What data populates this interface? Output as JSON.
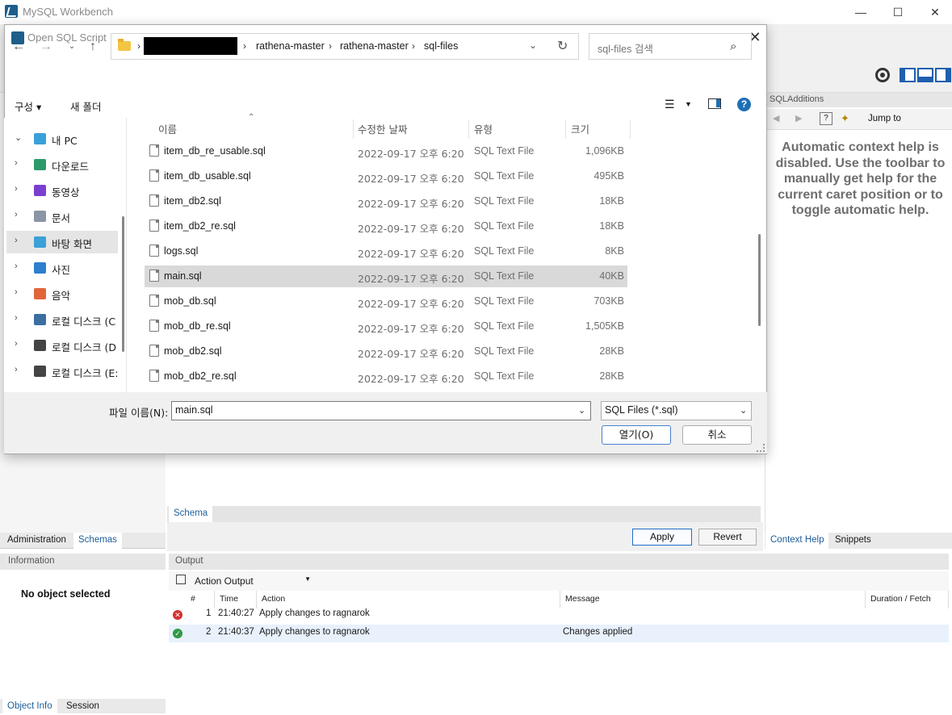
{
  "window": {
    "title": "MySQL Workbench",
    "minimize_glyph": "—",
    "maximize_glyph": "☐",
    "close_glyph": "✕"
  },
  "sidebar": {
    "tabs": [
      "Administration",
      "Schemas"
    ],
    "info_header": "Information",
    "no_object": "No object selected",
    "bottom_tabs": [
      "Object Info",
      "Session"
    ]
  },
  "editor": {
    "schema_tab": "Schema",
    "apply_label": "Apply",
    "revert_label": "Revert"
  },
  "right_panel": {
    "header": "SQLAdditions",
    "jump_to": "Jump to",
    "help_text": "Automatic context help is disabled. Use the toolbar to manually get help for the current caret position or to toggle automatic help.",
    "tabs": [
      "Context Help",
      "Snippets"
    ]
  },
  "output": {
    "header": "Output",
    "selector": "Action Output",
    "columns": [
      "#",
      "Time",
      "Action",
      "Message",
      "Duration / Fetch"
    ],
    "rows": [
      {
        "status": "error",
        "num": "1",
        "time": "21:40:27",
        "action": "Apply changes to ragnarok",
        "message": "",
        "duration": ""
      },
      {
        "status": "ok",
        "num": "2",
        "time": "21:40:37",
        "action": "Apply changes to ragnarok",
        "message": "Changes applied",
        "duration": ""
      }
    ]
  },
  "dialog": {
    "title": "Open SQL Script",
    "close_glyph": "✕",
    "breadcrumbs": [
      "rathena-master",
      "rathena-master",
      "sql-files"
    ],
    "search_placeholder": "sql-files 검색",
    "organize": "구성 ▾",
    "new_folder": "새 폴더",
    "nav": [
      {
        "label": "내 PC",
        "chev": "⌄",
        "color": "#3aa0d8"
      },
      {
        "label": "다운로드",
        "chev": "›",
        "color": "#2e9a6a"
      },
      {
        "label": "동영상",
        "chev": "›",
        "color": "#7b3fd0"
      },
      {
        "label": "문서",
        "chev": "›",
        "color": "#8a95a5"
      },
      {
        "label": "바탕 화면",
        "chev": "›",
        "color": "#3aa0d8"
      },
      {
        "label": "사진",
        "chev": "›",
        "color": "#2f7fd0"
      },
      {
        "label": "음악",
        "chev": "›",
        "color": "#e0663a"
      },
      {
        "label": "로컬 디스크 (C",
        "chev": "›",
        "color": "#3a6fa0"
      },
      {
        "label": "로컬 디스크 (D",
        "chev": "›",
        "color": "#444444"
      },
      {
        "label": "로컬 디스크 (E:",
        "chev": "›",
        "color": "#444444"
      }
    ],
    "selected_nav": 4,
    "columns": [
      "이름",
      "수정한 날짜",
      "유형",
      "크기"
    ],
    "files": [
      {
        "name": "item_db_re_usable.sql",
        "date": "2022-09-17 오후 6:20",
        "type": "SQL Text File",
        "size": "1,096KB"
      },
      {
        "name": "item_db_usable.sql",
        "date": "2022-09-17 오후 6:20",
        "type": "SQL Text File",
        "size": "495KB"
      },
      {
        "name": "item_db2.sql",
        "date": "2022-09-17 오후 6:20",
        "type": "SQL Text File",
        "size": "18KB"
      },
      {
        "name": "item_db2_re.sql",
        "date": "2022-09-17 오후 6:20",
        "type": "SQL Text File",
        "size": "18KB"
      },
      {
        "name": "logs.sql",
        "date": "2022-09-17 오후 6:20",
        "type": "SQL Text File",
        "size": "8KB"
      },
      {
        "name": "main.sql",
        "date": "2022-09-17 오후 6:20",
        "type": "SQL Text File",
        "size": "40KB"
      },
      {
        "name": "mob_db.sql",
        "date": "2022-09-17 오후 6:20",
        "type": "SQL Text File",
        "size": "703KB"
      },
      {
        "name": "mob_db_re.sql",
        "date": "2022-09-17 오후 6:20",
        "type": "SQL Text File",
        "size": "1,505KB"
      },
      {
        "name": "mob_db2.sql",
        "date": "2022-09-17 오후 6:20",
        "type": "SQL Text File",
        "size": "28KB"
      },
      {
        "name": "mob_db2_re.sql",
        "date": "2022-09-17 오후 6:20",
        "type": "SQL Text File",
        "size": "28KB"
      }
    ],
    "selected_file": 5,
    "filename_label": "파일 이름(N):",
    "filename_value": "main.sql",
    "filter_value": "SQL Files (*.sql)",
    "open_label": "열기(O)",
    "cancel_label": "취소"
  }
}
